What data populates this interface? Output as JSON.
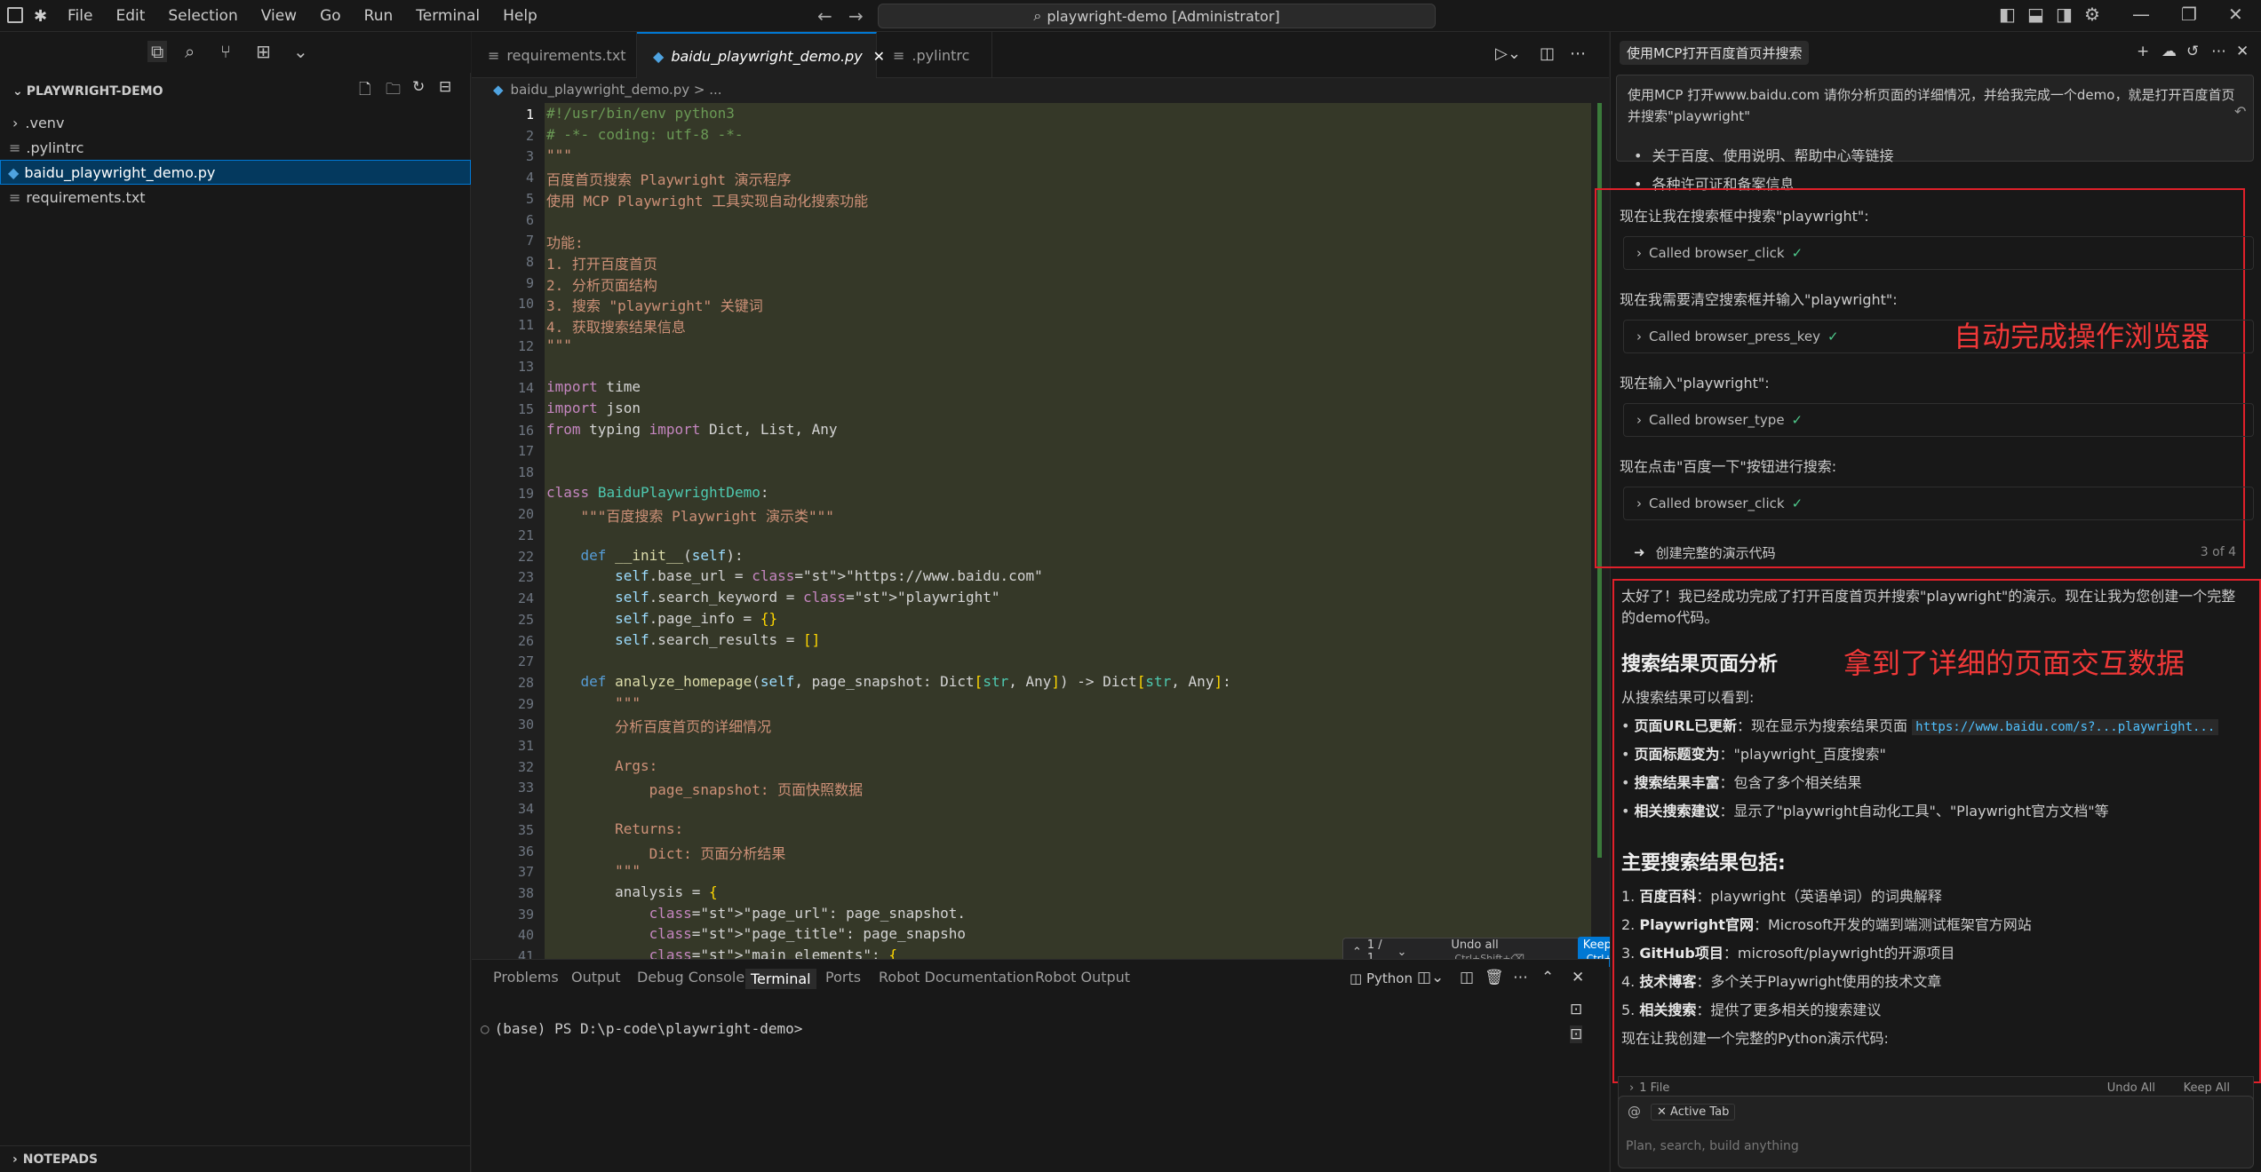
{
  "titlebar": {
    "menu": [
      "File",
      "Edit",
      "Selection",
      "View",
      "Go",
      "Run",
      "Terminal",
      "Help"
    ],
    "command_center": "playwright-demo [Administrator]"
  },
  "explorer": {
    "title": "PLAYWRIGHT-DEMO",
    "items": [
      {
        "label": ".venv",
        "kind": "folder"
      },
      {
        "label": ".pylintrc",
        "kind": "file"
      },
      {
        "label": "baidu_playwright_demo.py",
        "kind": "python"
      },
      {
        "label": "requirements.txt",
        "kind": "file"
      }
    ],
    "notepads": "NOTEPADS"
  },
  "tabs": [
    {
      "label": "requirements.txt"
    },
    {
      "label": "baidu_playwright_demo.py"
    },
    {
      "label": ".pylintrc"
    }
  ],
  "breadcrumb": "baidu_playwright_demo.py > ...",
  "code_lines": [
    "#!/usr/bin/env python3",
    "# -*- coding: utf-8 -*-",
    "\"\"\"",
    "百度首页搜索 Playwright 演示程序",
    "使用 MCP Playwright 工具实现自动化搜索功能",
    "",
    "功能:",
    "1. 打开百度首页",
    "2. 分析页面结构",
    "3. 搜索 \"playwright\" 关键词",
    "4. 获取搜索结果信息",
    "\"\"\"",
    "",
    "import time",
    "import json",
    "from typing import Dict, List, Any",
    "",
    "",
    "class BaiduPlaywrightDemo:",
    "    \"\"\"百度搜索 Playwright 演示类\"\"\"",
    "",
    "    def __init__(self):",
    "        self.base_url = \"https://www.baidu.com\"",
    "        self.search_keyword = \"playwright\"",
    "        self.page_info = {}",
    "        self.search_results = []",
    "",
    "    def analyze_homepage(self, page_snapshot: Dict[str, Any]) -> Dict[str, Any]:",
    "        \"\"\"",
    "        分析百度首页的详细情况",
    "",
    "        Args:",
    "            page_snapshot: 页面快照数据",
    "",
    "        Returns:",
    "            Dict: 页面分析结果",
    "        \"\"\"",
    "        analysis = {",
    "            \"page_url\": page_snapshot.",
    "            \"page_title\": page_snapsho",
    "            \"main_elements\": {"
  ],
  "diffbar": {
    "count": "1 / 1",
    "undo": "Undo all",
    "undo_key": "Ctrl+Shift+⌫",
    "keep": "Keep all",
    "keep_key": "Ctrl+⏎"
  },
  "panel": {
    "tabs": [
      "Problems",
      "Output",
      "Debug Console",
      "Terminal",
      "Ports",
      "Robot Documentation",
      "Robot Output"
    ],
    "active": "Terminal",
    "lang": "Python",
    "prompt": "(base) PS D:\\p-code\\playwright-demo>"
  },
  "chat": {
    "title": "使用MCP打开百度首页并搜索",
    "user_message": "使用MCP 打开www.baidu.com 请你分析页面的详细情况，并给我完成一个demo，就是打开百度首页并搜索\"playwright\"",
    "bullets_top": [
      "关于百度、使用说明、帮助中心等链接",
      "各种许可证和备案信息"
    ],
    "steps": [
      {
        "text": "现在让我在搜索框中搜索\"playwright\":",
        "tool": "Called browser_click"
      },
      {
        "text": "现在我需要清空搜索框并输入\"playwright\":",
        "tool": "Called browser_press_key"
      },
      {
        "text": "现在输入\"playwright\":",
        "tool": "Called browser_type"
      },
      {
        "text": "现在点击\"百度一下\"按钮进行搜索:",
        "tool": "Called browser_click"
      }
    ],
    "todo": {
      "label": "创建完整的演示代码",
      "count": "3 of 4"
    },
    "annotation1": "自动完成操作浏览器",
    "annotation2": "拿到了详细的页面交互数据",
    "summary": "太好了！我已经成功完成了打开百度首页并搜索\"playwright\"的演示。现在让我为您创建一个完整的demo代码。",
    "section1": "搜索结果页面分析",
    "section1_intro": "从搜索结果可以看到:",
    "section1_items": [
      {
        "b": "页面URL已更新",
        "t": "：现在显示为搜索结果页面 ",
        "code": "https://www.baidu.com/s?...playwright..."
      },
      {
        "b": "页面标题变为",
        "t": "：\"playwright_百度搜索\""
      },
      {
        "b": "搜索结果丰富",
        "t": "：包含了多个相关结果"
      },
      {
        "b": "相关搜索建议",
        "t": "：显示了\"playwright自动化工具\"、\"Playwright官方文档\"等"
      }
    ],
    "section2": "主要搜索结果包括:",
    "section2_items": [
      {
        "n": "1.",
        "b": "百度百科",
        "t": "：playwright（英语单词）的词典解释"
      },
      {
        "n": "2.",
        "b": "Playwright官网",
        "t": "：Microsoft开发的端到端测试框架官方网站"
      },
      {
        "n": "3.",
        "b": "GitHub项目",
        "t": "：microsoft/playwright的开源项目"
      },
      {
        "n": "4.",
        "b": "技术博客",
        "t": "：多个关于Playwright使用的技术文章"
      },
      {
        "n": "5.",
        "b": "相关搜索",
        "t": "：提供了更多相关的搜索建议"
      }
    ],
    "closing": "现在让我创建一个完整的Python演示代码:",
    "files_bar": {
      "label": "1 File",
      "undo": "Undo All",
      "keep": "Keep All"
    },
    "active_tab": "Active Tab",
    "input_placeholder": "Plan, search, build anything"
  }
}
